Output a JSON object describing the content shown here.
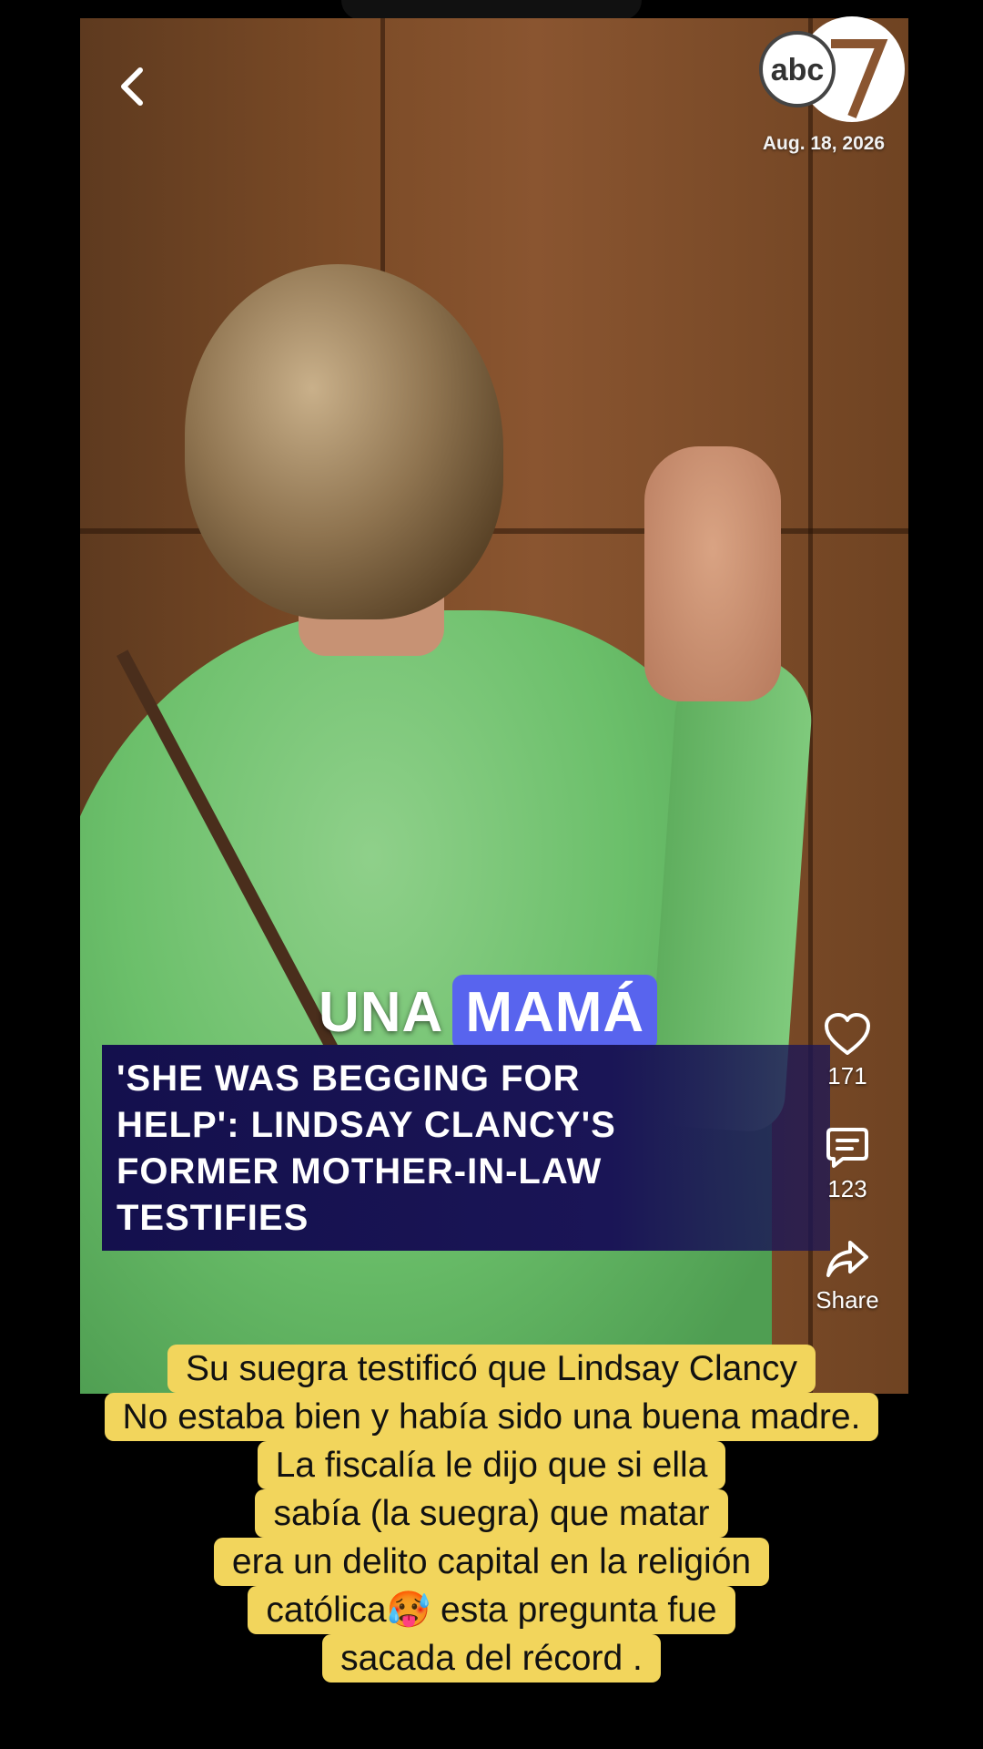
{
  "video": {
    "date": "Aug. 18, 2026",
    "logo_text": "abc"
  },
  "overlay": {
    "word_plain": "UNA",
    "word_highlight": "MAMÁ",
    "headline_lines": [
      "'SHE WAS BEGGING FOR",
      "HELP': LINDSAY CLANCY'S",
      "FORMER MOTHER-IN-LAW",
      "TESTIFIES"
    ]
  },
  "actions": {
    "like_count": "171",
    "comment_count": "123",
    "share_label": "Share"
  },
  "caption_lines": [
    "Su suegra testificó que Lindsay Clancy",
    "No estaba bien y había sido una buena madre.",
    "La fiscalía le dijo que si ella",
    "sabía (la suegra) que matar",
    "era un delito capital en la religión",
    "católica🥵 esta pregunta fue",
    "sacada del récord ."
  ],
  "colors": {
    "highlight": "#5864ee",
    "headline_bg": "#14104d",
    "caption_bg": "#f2d55c"
  }
}
